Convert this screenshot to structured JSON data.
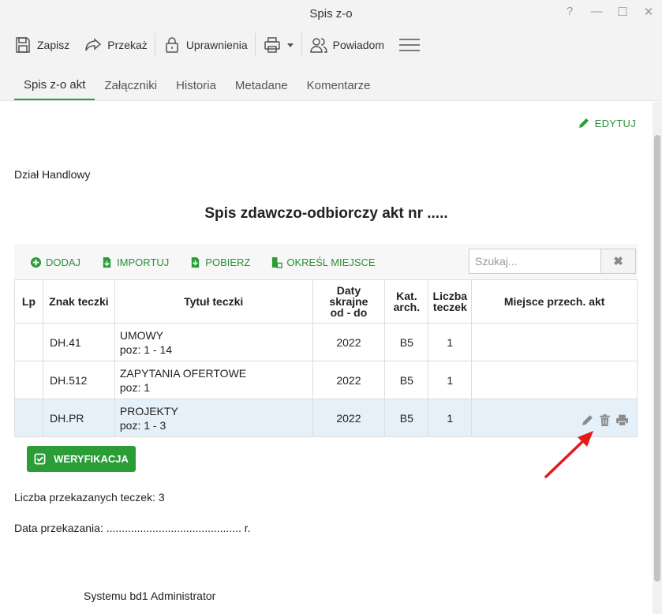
{
  "window": {
    "title": "Spis z-o",
    "help": "?",
    "minimize": "—",
    "maximize": "☐",
    "close": "✕"
  },
  "toolbar": {
    "save": "Zapisz",
    "forward": "Przekaż",
    "permissions": "Uprawnienia",
    "notify": "Powiadom"
  },
  "tabs": [
    {
      "label": "Spis z-o akt"
    },
    {
      "label": "Załączniki"
    },
    {
      "label": "Historia"
    },
    {
      "label": "Metadane"
    },
    {
      "label": "Komentarze"
    }
  ],
  "edit_label": "EDYTUJ",
  "department": "Dział Handlowy",
  "doc_title": "Spis zdawczo-odbiorczy akt nr .....",
  "grid_toolbar": {
    "add": "DODAJ",
    "import": "IMPORTUJ",
    "download": "POBIERZ",
    "location": "OKREŚL MIEJSCE",
    "search_placeholder": "Szukaj...",
    "clear": "✖"
  },
  "table": {
    "headers": {
      "lp": "Lp",
      "znak": "Znak teczki",
      "tytul": "Tytuł teczki",
      "daty_1": "Daty",
      "daty_2": "skrajne",
      "daty_3": "od - do",
      "kat_1": "Kat.",
      "kat_2": "arch.",
      "liczba_1": "Liczba",
      "liczba_2": "teczek",
      "miejsce": "Miejsce przech. akt"
    },
    "rows": [
      {
        "lp": "",
        "znak": "DH.41",
        "tytul": "UMOWY",
        "poz": "poz: 1 - 14",
        "daty": "2022",
        "kat": "B5",
        "liczba": "1",
        "miejsce": ""
      },
      {
        "lp": "",
        "znak": "DH.512",
        "tytul": "ZAPYTANIA OFERTOWE",
        "poz": "poz: 1",
        "daty": "2022",
        "kat": "B5",
        "liczba": "1",
        "miejsce": ""
      },
      {
        "lp": "",
        "znak": "DH.PR",
        "tytul": "PROJEKTY",
        "poz": "poz: 1 - 3",
        "daty": "2022",
        "kat": "B5",
        "liczba": "1",
        "miejsce": ""
      }
    ]
  },
  "verify_label": "WERYFIKACJA",
  "count_text": "Liczba przekazanych teczek: 3",
  "date_text": "Data przekazania: ............................................ r.",
  "admin_text": "Systemu bd1 Administrator",
  "colors": {
    "accent": "#2a9d37",
    "selected_row": "#e6f0f8",
    "annotation_arrow": "#e21b1b"
  }
}
